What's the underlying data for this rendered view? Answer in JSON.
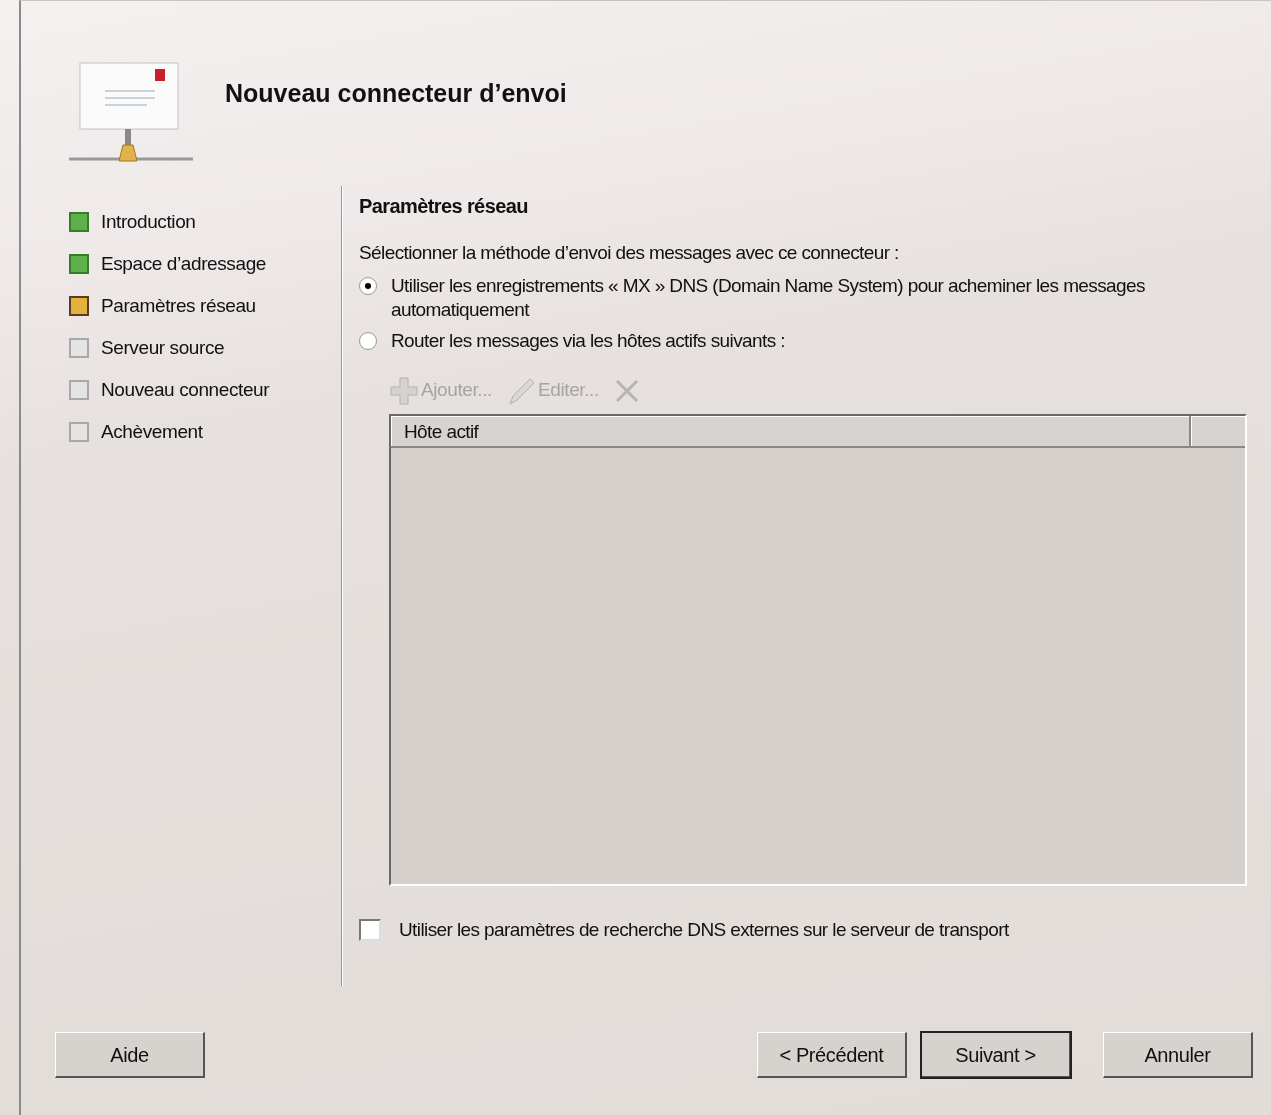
{
  "title": "Nouveau connecteur d’envoi",
  "steps": [
    {
      "label": "Introduction",
      "kind": "done"
    },
    {
      "label": "Espace d’adressage",
      "kind": "done"
    },
    {
      "label": "Paramètres réseau",
      "kind": "current"
    },
    {
      "label": "Serveur source",
      "kind": "pending"
    },
    {
      "label": "Nouveau connecteur",
      "kind": "pending"
    },
    {
      "label": "Achèvement",
      "kind": "pending"
    }
  ],
  "section_title": "Paramètres réseau",
  "prompt": "Sélectionner la méthode d’envoi des messages avec ce connecteur :",
  "options": [
    {
      "label": "Utiliser les enregistrements « MX » DNS (Domain Name System) pour acheminer les messages automatiquement",
      "selected": true
    },
    {
      "label": "Router les messages via les hôtes actifs suivants :",
      "selected": false
    }
  ],
  "toolbar": [
    {
      "kind": "add",
      "label": "Ajouter...",
      "disabled": true
    },
    {
      "kind": "edit",
      "label": "Editer...",
      "disabled": true
    },
    {
      "kind": "delete",
      "disabled": true
    }
  ],
  "table": {
    "columns": [
      "Hôte actif"
    ]
  },
  "checkbox": {
    "label": "Utiliser les paramètres de recherche DNS externes sur le serveur de transport",
    "checked": false
  },
  "buttons": [
    {
      "label": "Aide",
      "kind": "help",
      "default": false
    },
    {
      "label": "< Précédent",
      "kind": "nav",
      "default": false
    },
    {
      "label": "Suivant >",
      "kind": "nav",
      "default": true
    },
    {
      "label": "Annuler",
      "kind": "nav",
      "default": false
    }
  ]
}
